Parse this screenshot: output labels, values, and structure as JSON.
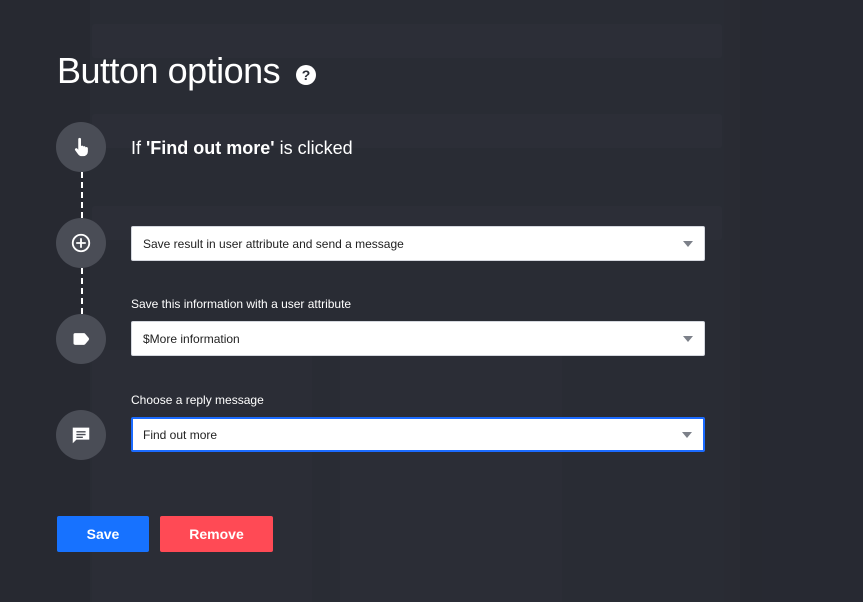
{
  "modal": {
    "title": "Button options",
    "help_icon": "question-circle-icon",
    "trigger": {
      "prefix": "If ",
      "button_name": "'Find out more'",
      "suffix": " is clicked",
      "icon": "pointer-hand-icon"
    },
    "action": {
      "icon": "plus-circle-icon",
      "selected": "Save result in user attribute and send a message"
    },
    "attribute": {
      "icon": "tag-icon",
      "label": "Save this information with a user attribute",
      "selected": "$More information"
    },
    "reply": {
      "icon": "chat-bubble-icon",
      "label": "Choose a reply message",
      "selected": "Find out more"
    },
    "buttons": {
      "save": "Save",
      "remove": "Remove"
    }
  },
  "colors": {
    "background": "#2a2d36",
    "primary": "#1772ff",
    "danger": "#ff4a55",
    "focus_border": "#1b6bff"
  }
}
